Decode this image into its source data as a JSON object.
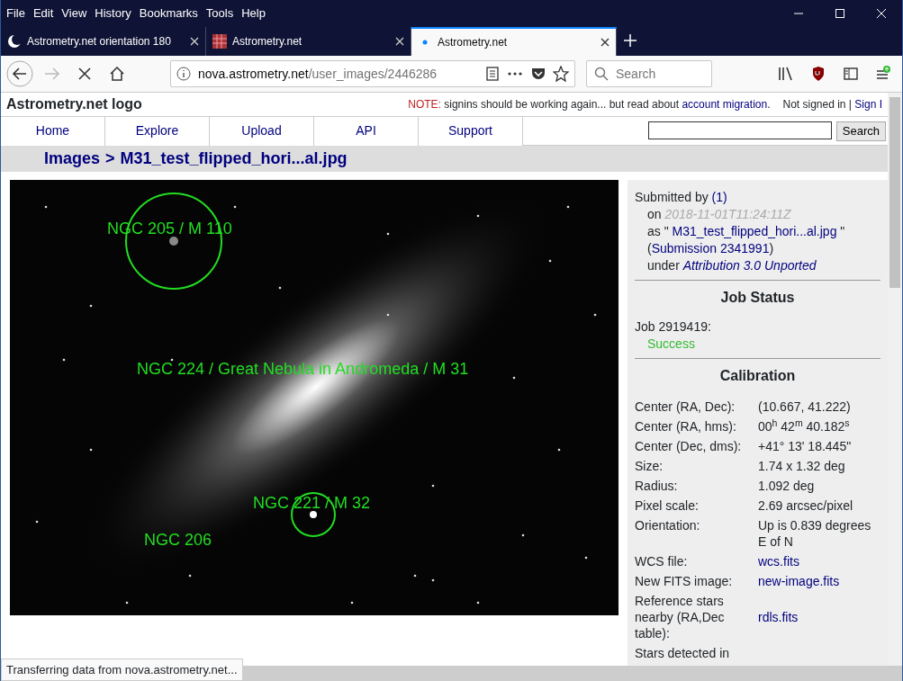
{
  "menu": [
    "File",
    "Edit",
    "View",
    "History",
    "Bookmarks",
    "Tools",
    "Help"
  ],
  "tabs": [
    {
      "title": "Astrometry.net orientation 180",
      "kind": "moon",
      "selected": false
    },
    {
      "title": "Astrometry.net",
      "kind": "grid",
      "selected": false
    },
    {
      "title": "Astrometry.net",
      "kind": "loading",
      "selected": true
    }
  ],
  "toolbar": {
    "forward_disabled": true,
    "url_host": "nova.astrometry.net",
    "url_path": "/user_images/2446286",
    "search_placeholder": "Search"
  },
  "site": {
    "logo": "Astrometry.net logo",
    "note_label": "NOTE:",
    "note_text": "signins should be working again... but read about",
    "note_link": "account migration",
    "note_end": ".",
    "signin_text": "Not signed in |",
    "signin_link": "Sign I"
  },
  "nav": {
    "items": [
      "Home",
      "Explore",
      "Upload",
      "API",
      "Support"
    ],
    "search_button": "Search"
  },
  "breadcrumb": [
    {
      "text": "Images"
    },
    {
      "text": ">"
    },
    {
      "text": "M31_test_flipped_hori...al.jpg"
    }
  ],
  "image": {
    "annotations": [
      {
        "label": "NGC 205 / M 110",
        "circled": true
      },
      {
        "label": "NGC 224 / Great Nebula in Andromeda / M 31",
        "circled": false
      },
      {
        "label": "NGC 221 / M 32",
        "circled": true
      },
      {
        "label": "NGC 206",
        "circled": false
      }
    ]
  },
  "submission": {
    "by_label": "Submitted by",
    "by_value": "(1)",
    "on_label": "on",
    "date": "2018-11-01T11:24:11Z",
    "as_label": "as \"",
    "as_link": "M31_test_flipped_hori...al.jpg",
    "as_end": "\"",
    "sub_open": "(",
    "sub_link": "Submission 2341991",
    "sub_close": ")",
    "under_label": "under",
    "license": "Attribution 3.0 Unported"
  },
  "job": {
    "heading": "Job Status",
    "job_label": "Job 2919419:",
    "status": "Success"
  },
  "calibration": {
    "heading": "Calibration",
    "rows": [
      {
        "label": "Center (RA, Dec):",
        "value": "(10.667, 41.222)",
        "kind": "text"
      },
      {
        "label": "Center (RA, hms):",
        "value": "00$^{h}$ 42$^{m}$ 40.182$^{s}$",
        "kind": "text"
      },
      {
        "label": "Center (Dec, dms):",
        "value": "+41° 13' 18.445\"",
        "kind": "text"
      },
      {
        "label": "Size:",
        "value": "1.74 x 1.32 deg",
        "kind": "text"
      },
      {
        "label": "Radius:",
        "value": "1.092 deg",
        "kind": "text"
      },
      {
        "label": "Pixel scale:",
        "value": "2.69 arcsec/pixel",
        "kind": "text"
      },
      {
        "label": "Orientation:",
        "value": "Up is 0.839 degrees E of N",
        "kind": "text"
      },
      {
        "label": "WCS file:",
        "value": "wcs.fits",
        "kind": "link"
      },
      {
        "label": "New FITS image:",
        "value": "new-image.fits",
        "kind": "link"
      },
      {
        "label": "Reference stars nearby (RA,Dec table):",
        "value": "rdls.fits",
        "kind": "link"
      },
      {
        "label": "Stars detected in",
        "kind": "text"
      }
    ]
  },
  "status_text": "Transferring data from nova.astrometry.net..."
}
